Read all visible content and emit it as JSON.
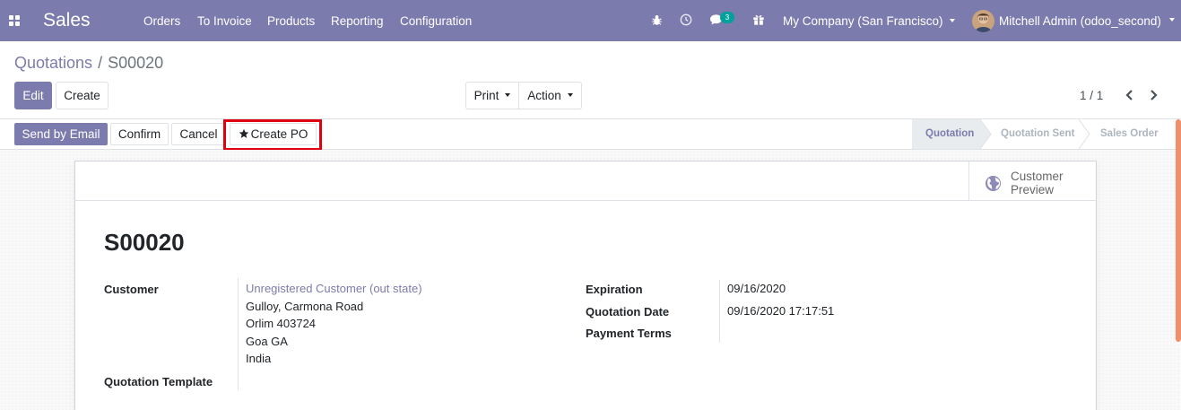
{
  "navbar": {
    "app_name": "Sales",
    "menu": [
      "Orders",
      "To Invoice",
      "Products",
      "Reporting",
      "Configuration"
    ],
    "messages_count": "3",
    "company": "My Company (San Francisco)",
    "user": "Mitchell Admin (odoo_second)",
    "color": "#7c7bad"
  },
  "breadcrumb": {
    "parent": "Quotations",
    "separator": "/",
    "current": "S00020"
  },
  "toolbar": {
    "edit": "Edit",
    "create": "Create",
    "print": "Print",
    "action": "Action"
  },
  "pager": {
    "value": "1 / 1"
  },
  "statusbar": {
    "buttons": {
      "send_email": "Send by Email",
      "confirm": "Confirm",
      "cancel": "Cancel",
      "create_po": "Create PO"
    },
    "stages": [
      "Quotation",
      "Quotation Sent",
      "Sales Order"
    ],
    "active_stage": "Quotation",
    "highlight_color": "#e0000f"
  },
  "sheet": {
    "preview_button": {
      "line1": "Customer",
      "line2": "Preview"
    },
    "title": "S00020",
    "fields": {
      "customer_label": "Customer",
      "customer_name": "Unregistered Customer (out state)",
      "address": [
        "Gulloy, Carmona Road",
        "Orlim 403724",
        "Goa GA",
        "India"
      ],
      "template_label": "Quotation Template",
      "expiration_label": "Expiration",
      "expiration_value": "09/16/2020",
      "quotation_date_label": "Quotation Date",
      "quotation_date_value": "09/16/2020 17:17:51",
      "payment_terms_label": "Payment Terms"
    }
  }
}
